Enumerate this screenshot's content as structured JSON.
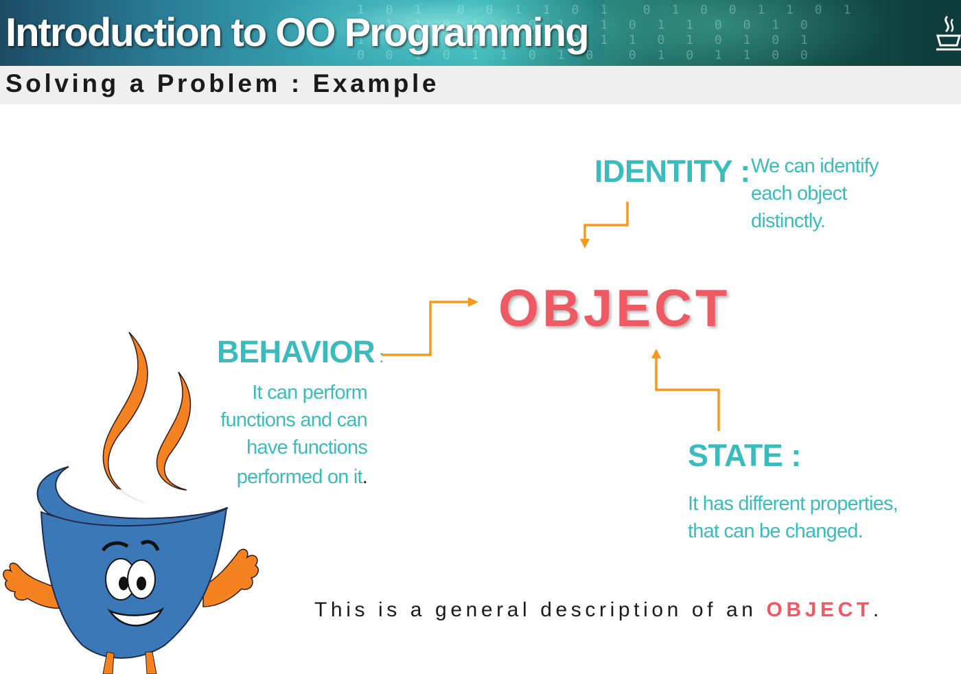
{
  "header": {
    "title": "Introduction to OO Programming",
    "binary_pattern": "1 0 1  0 0 1 1 0 1  0 1 0 0 1 1 0 1\n0 1 1 0 1 0 0 1  1 0 1 1 0 0 1 0\n1 1 0 1 0 0 1  0 1 1 0 1 0 1 0 1\n0 0 1 0 1 1 0 1 0  0 1 0 1 1 0 0"
  },
  "subtitle": "Solving a Problem : Example",
  "diagram": {
    "center": "OBJECT",
    "identity": {
      "heading": "IDENTITY :",
      "lines": [
        "We can identify",
        "each object",
        "distinctly."
      ]
    },
    "behavior": {
      "heading": "BEHAVIOR",
      "colon": ":",
      "lines": [
        "It can perform",
        "functions and can",
        "have functions",
        "performed on it"
      ],
      "end_mark": "."
    },
    "state": {
      "heading": "STATE :",
      "lines": [
        "It has different properties,",
        "that can be changed."
      ]
    }
  },
  "footer": {
    "text_before": "This is a general description of an ",
    "highlight": "OBJECT",
    "text_after": "."
  },
  "colors": {
    "teal": "#3bbcbc",
    "object_red": "#ee5a63",
    "arrow_orange": "#f39a1e",
    "mascot_blue": "#3b78b8"
  }
}
